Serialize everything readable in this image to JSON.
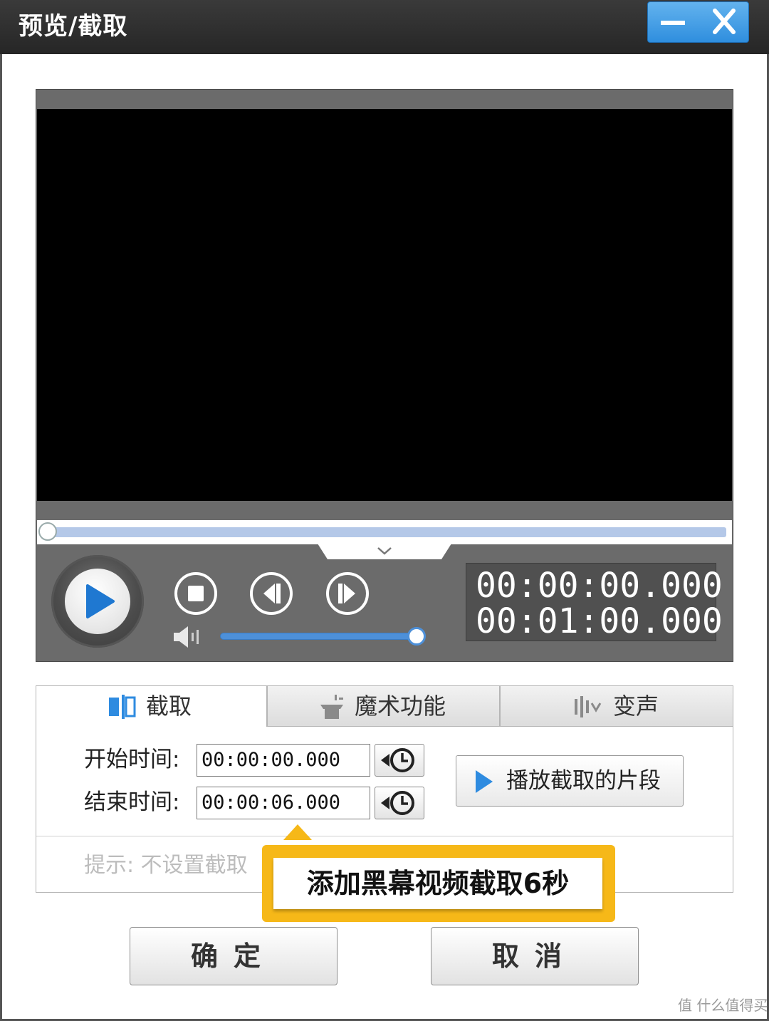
{
  "window": {
    "title": "预览/截取",
    "minimize_icon": "minimize-icon",
    "close_icon": "close-icon",
    "accent_color": "#3d9be6"
  },
  "player": {
    "current_time": "00:00:00.000",
    "total_time": "00:01:00.000",
    "playback_progress": 0,
    "volume_level": 1.0,
    "controls": [
      "play-icon",
      "stop-icon",
      "previous-frame-icon",
      "next-frame-icon",
      "volume-icon"
    ]
  },
  "tabs": [
    {
      "label": "截取",
      "icon": "cut-icon",
      "active": true
    },
    {
      "label": "魔术功能",
      "icon": "magic-hat-icon",
      "active": false
    },
    {
      "label": "变声",
      "icon": "sound-wave-icon",
      "active": false
    }
  ],
  "cut": {
    "start_label": "开始时间:",
    "start_value": "00:00:00.000",
    "end_label": "结束时间:",
    "end_value": "00:00:06.000",
    "play_clip_label": "播放截取的片段",
    "hint": "提示: 不设置截取"
  },
  "tooltip": {
    "text": "添加黑幕视频截取6秒",
    "color": "#f6b818"
  },
  "buttons": {
    "ok": "确定",
    "cancel": "取消"
  },
  "watermark": "值 什么值得买"
}
